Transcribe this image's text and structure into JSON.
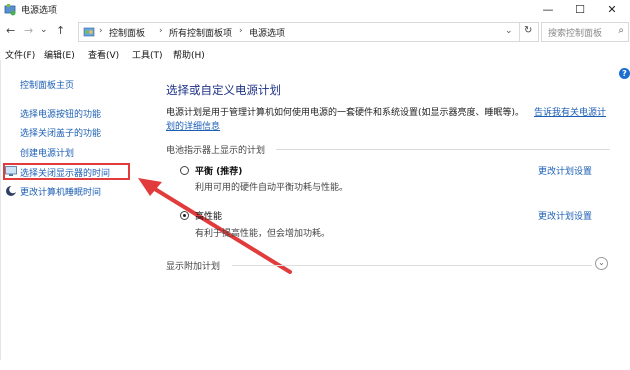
{
  "window": {
    "title": "电源选项",
    "minimize": "—",
    "maximize": "☐",
    "close": "✕"
  },
  "address": {
    "back": "←",
    "forward": "→",
    "dropdown": "⌄",
    "up": "↑",
    "crumbs": [
      "控制面板",
      "所有控制面板项",
      "电源选项"
    ],
    "separator": "›",
    "refresh": "↻",
    "search_placeholder": "搜索控制面板",
    "search_icon": "⌕"
  },
  "menu": [
    "文件(F)",
    "编辑(E)",
    "查看(V)",
    "工具(T)",
    "帮助(H)"
  ],
  "help": "?",
  "sidebar": {
    "items": [
      {
        "label": "控制面板主页"
      },
      {
        "label": "选择电源按钮的功能"
      },
      {
        "label": "选择关闭盖子的功能"
      },
      {
        "label": "创建电源计划"
      },
      {
        "label": "选择关闭显示器的时间",
        "icon": "monitor-icon"
      },
      {
        "label": "更改计算机睡眠时间",
        "icon": "moon-icon"
      }
    ]
  },
  "main": {
    "title": "选择或自定义电源计划",
    "description_line1": "电源计划是用于管理计算机如何使用电源的一套硬件和系统设置(如显示器亮度、睡眠等)。",
    "learn_more_line1": "告诉我有关电源计",
    "learn_more_line2": "划的详细信息",
    "battery_section": "电池指示器上显示的计划",
    "plans": [
      {
        "name": "平衡 (推荐)",
        "desc": "利用可用的硬件自动平衡功耗与性能。",
        "change": "更改计划设置",
        "selected": false
      },
      {
        "name": "高性能",
        "desc": "有利于提高性能，但会增加功耗。",
        "change": "更改计划设置",
        "selected": true
      }
    ],
    "additional_section": "显示附加计划",
    "expand_icon": "⌄"
  },
  "annotation": {
    "frame_color": "#e23b3b",
    "arrow_color": "#e23b3b"
  }
}
